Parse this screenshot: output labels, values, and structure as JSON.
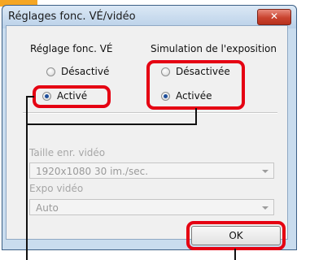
{
  "window": {
    "title": "Réglages fonc. VÉ/vidéo",
    "close_glyph": "✕"
  },
  "live_view": {
    "heading": "Réglage fonc. VÉ",
    "options": [
      {
        "label": "Désactivé",
        "checked": false
      },
      {
        "label": "Activé",
        "checked": true
      }
    ]
  },
  "exposure_sim": {
    "heading": "Simulation de l'exposition",
    "options": [
      {
        "label": "Désactivée",
        "checked": false
      },
      {
        "label": "Activée",
        "checked": true
      }
    ]
  },
  "movie_size": {
    "label": "Taille enr. vidéo",
    "value": "1920x1080  30 im./sec.",
    "enabled": false
  },
  "movie_exposure": {
    "label": "Expo vidéo",
    "value": "Auto",
    "enabled": false
  },
  "ok_button": {
    "label": "OK"
  },
  "highlight_color": "#e50012",
  "tab_color": "#f5a623"
}
